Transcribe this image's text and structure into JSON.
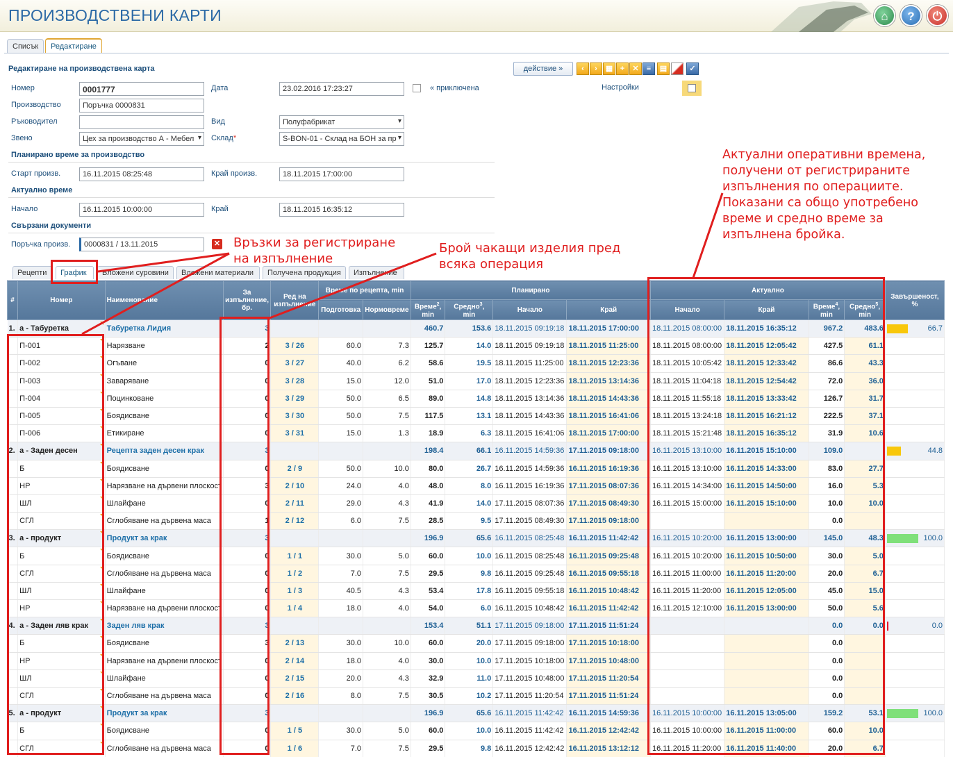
{
  "header": {
    "title": "ПРОИЗВОДСТВЕНИ КАРТИ",
    "home_icon": "home-icon",
    "help_icon": "help-icon",
    "power_icon": "power-icon"
  },
  "main_tabs": [
    "Списък",
    "Редактиране"
  ],
  "form": {
    "title": "Редактиране на производствена карта",
    "action_label": "действие  »",
    "fields": {
      "nomer_label": "Номер",
      "nomer": "0001777",
      "data_label": "Дата",
      "data": "23.02.2016 17:23:27",
      "closed_label": "« приключена",
      "settings_label": "Настройки",
      "proizv_label": "Производство",
      "proizv": "Поръчка 0000831",
      "rakovod_label": "Ръководител",
      "rakovod": "",
      "vid_label": "Вид",
      "vid": "Полуфабрикат",
      "zveno_label": "Звено",
      "zveno": "Цех за производство А - Мебел",
      "sklad_label": "Склад",
      "sklad": "S-BON-01 - Склад на БОН за пр"
    },
    "planned": {
      "title": "Планирано време за производство",
      "start_label": "Старт произв.",
      "start": "16.11.2015 08:25:48",
      "end_label": "Край произв.",
      "end": "18.11.2015 17:00:00"
    },
    "actual": {
      "title": "Актуално време",
      "start_label": "Начало",
      "start": "16.11.2015 10:00:00",
      "end_label": "Край",
      "end": "18.11.2015 16:35:12"
    },
    "docs": {
      "title": "Свързани документи",
      "order_label": "Поръчка произв.",
      "order": "0000831 / 13.11.2015"
    }
  },
  "sub_tabs": [
    "Рецепти",
    "График",
    "Вложени суровини",
    "Вложени материали",
    "Получена продукция",
    "Изпълнение"
  ],
  "grid": {
    "headers": {
      "idx": "#",
      "num": "Номер",
      "name": "Наименование",
      "qty": "За изпълнение, бр.",
      "order": "Ред на изпълнение",
      "recipe": "Време по рецепта, min",
      "prep": "Подготовка",
      "norm": "Нормовреме",
      "planned": "Планирано",
      "actual": "Актуално",
      "p_time": "Време",
      "p_avg": "Средно",
      "min": "min",
      "start": "Начало",
      "end": "Край",
      "completion": "Завършеност, %",
      "sup2": "2",
      "sup3": "3",
      "sup4": "4",
      "sup5": "5"
    },
    "rows": [
      {
        "g": 1,
        "idx": "1.",
        "num": "а - Табуретка",
        "name": "Табуретка Лидия",
        "qty": "3",
        "ord": "",
        "prep": "",
        "norm": "",
        "pt": "460.7",
        "pa": "153.6",
        "ps": "18.11.2015 09:19:18",
        "pe": "18.11.2015 17:00:00",
        "as": "18.11.2015 08:00:00",
        "ae": "18.11.2015 16:35:12",
        "at": "967.2",
        "aa": "483.6",
        "pct": "66.7",
        "bar": 0.667,
        "barc": "#f8c70b"
      },
      {
        "g": 0,
        "num": "П-001",
        "name": "Нарязване",
        "qty": "2",
        "ord": "3 / 26",
        "prep": "60.0",
        "norm": "7.3",
        "pt": "125.7",
        "pa": "14.0",
        "ps": "18.11.2015 09:19:18",
        "pe": "18.11.2015 11:25:00",
        "as": "18.11.2015 08:00:00",
        "ae": "18.11.2015 12:05:42",
        "at": "427.5",
        "aa": "61.1"
      },
      {
        "g": 0,
        "num": "П-002",
        "name": "Огъване",
        "qty": "0",
        "ord": "3 / 27",
        "prep": "40.0",
        "norm": "6.2",
        "pt": "58.6",
        "pa": "19.5",
        "ps": "18.11.2015 11:25:00",
        "pe": "18.11.2015 12:23:36",
        "as": "18.11.2015 10:05:42",
        "ae": "18.11.2015 12:33:42",
        "at": "86.6",
        "aa": "43.3"
      },
      {
        "g": 0,
        "num": "П-003",
        "name": "Заваряване",
        "qty": "0",
        "ord": "3 / 28",
        "prep": "15.0",
        "norm": "12.0",
        "pt": "51.0",
        "pa": "17.0",
        "ps": "18.11.2015 12:23:36",
        "pe": "18.11.2015 13:14:36",
        "as": "18.11.2015 11:04:18",
        "ae": "18.11.2015 12:54:42",
        "at": "72.0",
        "aa": "36.0"
      },
      {
        "g": 0,
        "num": "П-004",
        "name": "Поцинковане",
        "qty": "0",
        "ord": "3 / 29",
        "prep": "50.0",
        "norm": "6.5",
        "pt": "89.0",
        "pa": "14.8",
        "ps": "18.11.2015 13:14:36",
        "pe": "18.11.2015 14:43:36",
        "as": "18.11.2015 11:55:18",
        "ae": "18.11.2015 13:33:42",
        "at": "126.7",
        "aa": "31.7"
      },
      {
        "g": 0,
        "num": "П-005",
        "name": "Боядисване",
        "qty": "0",
        "ord": "3 / 30",
        "prep": "50.0",
        "norm": "7.5",
        "pt": "117.5",
        "pa": "13.1",
        "ps": "18.11.2015 14:43:36",
        "pe": "18.11.2015 16:41:06",
        "as": "18.11.2015 13:24:18",
        "ae": "18.11.2015 16:21:12",
        "at": "222.5",
        "aa": "37.1"
      },
      {
        "g": 0,
        "num": "П-006",
        "name": "Етикиране",
        "qty": "0",
        "ord": "3 / 31",
        "prep": "15.0",
        "norm": "1.3",
        "pt": "18.9",
        "pa": "6.3",
        "ps": "18.11.2015 16:41:06",
        "pe": "18.11.2015 17:00:00",
        "as": "18.11.2015 15:21:48",
        "ae": "18.11.2015 16:35:12",
        "at": "31.9",
        "aa": "10.6"
      },
      {
        "g": 1,
        "idx": "2.",
        "num": "а - Заден десен",
        "name": "Рецепта заден десен крак",
        "qty": "3",
        "ord": "",
        "prep": "",
        "norm": "",
        "pt": "198.4",
        "pa": "66.1",
        "ps": "16.11.2015 14:59:36",
        "pe": "17.11.2015 09:18:00",
        "as": "16.11.2015 13:10:00",
        "ae": "16.11.2015 15:10:00",
        "at": "109.0",
        "aa": "",
        "pct": "44.8",
        "bar": 0.448,
        "barc": "#f8c70b"
      },
      {
        "g": 0,
        "num": "Б",
        "name": "Боядисване",
        "qty": "0",
        "ord": "2 / 9",
        "prep": "50.0",
        "norm": "10.0",
        "pt": "80.0",
        "pa": "26.7",
        "ps": "16.11.2015 14:59:36",
        "pe": "16.11.2015 16:19:36",
        "as": "16.11.2015 13:10:00",
        "ae": "16.11.2015 14:33:00",
        "at": "83.0",
        "aa": "27.7"
      },
      {
        "g": 0,
        "num": "НР",
        "name": "Нарязване на дървени плоскост",
        "qty": "3",
        "ord": "2 / 10",
        "prep": "24.0",
        "norm": "4.0",
        "pt": "48.0",
        "pa": "8.0",
        "ps": "16.11.2015 16:19:36",
        "pe": "17.11.2015 08:07:36",
        "as": "16.11.2015 14:34:00",
        "ae": "16.11.2015 14:50:00",
        "at": "16.0",
        "aa": "5.3"
      },
      {
        "g": 0,
        "num": "ШЛ",
        "name": "Шлайфане",
        "qty": "0",
        "ord": "2 / 11",
        "prep": "29.0",
        "norm": "4.3",
        "pt": "41.9",
        "pa": "14.0",
        "ps": "17.11.2015 08:07:36",
        "pe": "17.11.2015 08:49:30",
        "as": "16.11.2015 15:00:00",
        "ae": "16.11.2015 15:10:00",
        "at": "10.0",
        "aa": "10.0"
      },
      {
        "g": 0,
        "num": "СГЛ",
        "name": "Сглобяване на дървена маса",
        "qty": "1",
        "ord": "2 / 12",
        "prep": "6.0",
        "norm": "7.5",
        "pt": "28.5",
        "pa": "9.5",
        "ps": "17.11.2015 08:49:30",
        "pe": "17.11.2015 09:18:00",
        "as": "",
        "ae": "",
        "at": "0.0",
        "aa": ""
      },
      {
        "g": 1,
        "idx": "3.",
        "num": "а - продукт",
        "name": "Продукт за крак",
        "qty": "3",
        "ord": "",
        "prep": "",
        "norm": "",
        "pt": "196.9",
        "pa": "65.6",
        "ps": "16.11.2015 08:25:48",
        "pe": "16.11.2015 11:42:42",
        "as": "16.11.2015 10:20:00",
        "ae": "16.11.2015 13:00:00",
        "at": "145.0",
        "aa": "48.3",
        "pct": "100.0",
        "bar": 1,
        "barc": "#7fe07a"
      },
      {
        "g": 0,
        "num": "Б",
        "name": "Боядисване",
        "qty": "0",
        "ord": "1 / 1",
        "prep": "30.0",
        "norm": "5.0",
        "pt": "60.0",
        "pa": "10.0",
        "ps": "16.11.2015 08:25:48",
        "pe": "16.11.2015 09:25:48",
        "as": "16.11.2015 10:20:00",
        "ae": "16.11.2015 10:50:00",
        "at": "30.0",
        "aa": "5.0"
      },
      {
        "g": 0,
        "num": "СГЛ",
        "name": "Сглобяване на дървена маса",
        "qty": "0",
        "ord": "1 / 2",
        "prep": "7.0",
        "norm": "7.5",
        "pt": "29.5",
        "pa": "9.8",
        "ps": "16.11.2015 09:25:48",
        "pe": "16.11.2015 09:55:18",
        "as": "16.11.2015 11:00:00",
        "ae": "16.11.2015 11:20:00",
        "at": "20.0",
        "aa": "6.7"
      },
      {
        "g": 0,
        "num": "ШЛ",
        "name": "Шлайфане",
        "qty": "0",
        "ord": "1 / 3",
        "prep": "40.5",
        "norm": "4.3",
        "pt": "53.4",
        "pa": "17.8",
        "ps": "16.11.2015 09:55:18",
        "pe": "16.11.2015 10:48:42",
        "as": "16.11.2015 11:20:00",
        "ae": "16.11.2015 12:05:00",
        "at": "45.0",
        "aa": "15.0"
      },
      {
        "g": 0,
        "num": "НР",
        "name": "Нарязване на дървени плоскост",
        "qty": "0",
        "ord": "1 / 4",
        "prep": "18.0",
        "norm": "4.0",
        "pt": "54.0",
        "pa": "6.0",
        "ps": "16.11.2015 10:48:42",
        "pe": "16.11.2015 11:42:42",
        "as": "16.11.2015 12:10:00",
        "ae": "16.11.2015 13:00:00",
        "at": "50.0",
        "aa": "5.6"
      },
      {
        "g": 1,
        "idx": "4.",
        "num": "а - Заден ляв крак",
        "name": "Заден ляв крак",
        "qty": "3",
        "ord": "",
        "prep": "",
        "norm": "",
        "pt": "153.4",
        "pa": "51.1",
        "ps": "17.11.2015 09:18:00",
        "pe": "17.11.2015 11:51:24",
        "as": "",
        "ae": "",
        "at": "0.0",
        "aa": "0.0",
        "pct": "0.0",
        "bar": 0.02,
        "barc": "#e8002a"
      },
      {
        "g": 0,
        "num": "Б",
        "name": "Боядисване",
        "qty": "3",
        "ord": "2 / 13",
        "prep": "30.0",
        "norm": "10.0",
        "pt": "60.0",
        "pa": "20.0",
        "ps": "17.11.2015 09:18:00",
        "pe": "17.11.2015 10:18:00",
        "as": "",
        "ae": "",
        "at": "0.0",
        "aa": ""
      },
      {
        "g": 0,
        "num": "НР",
        "name": "Нарязване на дървени плоскост",
        "qty": "0",
        "ord": "2 / 14",
        "prep": "18.0",
        "norm": "4.0",
        "pt": "30.0",
        "pa": "10.0",
        "ps": "17.11.2015 10:18:00",
        "pe": "17.11.2015 10:48:00",
        "as": "",
        "ae": "",
        "at": "0.0",
        "aa": ""
      },
      {
        "g": 0,
        "num": "ШЛ",
        "name": "Шлайфане",
        "qty": "0",
        "ord": "2 / 15",
        "prep": "20.0",
        "norm": "4.3",
        "pt": "32.9",
        "pa": "11.0",
        "ps": "17.11.2015 10:48:00",
        "pe": "17.11.2015 11:20:54",
        "as": "",
        "ae": "",
        "at": "0.0",
        "aa": ""
      },
      {
        "g": 0,
        "num": "СГЛ",
        "name": "Сглобяване на дървена маса",
        "qty": "0",
        "ord": "2 / 16",
        "prep": "8.0",
        "norm": "7.5",
        "pt": "30.5",
        "pa": "10.2",
        "ps": "17.11.2015 11:20:54",
        "pe": "17.11.2015 11:51:24",
        "as": "",
        "ae": "",
        "at": "0.0",
        "aa": ""
      },
      {
        "g": 1,
        "idx": "5.",
        "num": "а - продукт",
        "name": "Продукт за крак",
        "qty": "3",
        "ord": "",
        "prep": "",
        "norm": "",
        "pt": "196.9",
        "pa": "65.6",
        "ps": "16.11.2015 11:42:42",
        "pe": "16.11.2015 14:59:36",
        "as": "16.11.2015 10:00:00",
        "ae": "16.11.2015 13:05:00",
        "at": "159.2",
        "aa": "53.1",
        "pct": "100.0",
        "bar": 1,
        "barc": "#7fe07a"
      },
      {
        "g": 0,
        "num": "Б",
        "name": "Боядисване",
        "qty": "0",
        "ord": "1 / 5",
        "prep": "30.0",
        "norm": "5.0",
        "pt": "60.0",
        "pa": "10.0",
        "ps": "16.11.2015 11:42:42",
        "pe": "16.11.2015 12:42:42",
        "as": "16.11.2015 10:00:00",
        "ae": "16.11.2015 11:00:00",
        "at": "60.0",
        "aa": "10.0"
      },
      {
        "g": 0,
        "num": "СГЛ",
        "name": "Сглобяване на дървена маса",
        "qty": "0",
        "ord": "1 / 6",
        "prep": "7.0",
        "norm": "7.5",
        "pt": "29.5",
        "pa": "9.8",
        "ps": "16.11.2015 12:42:42",
        "pe": "16.11.2015 13:12:12",
        "as": "16.11.2015 11:20:00",
        "ae": "16.11.2015 11:40:00",
        "at": "20.0",
        "aa": "6.7"
      }
    ]
  },
  "annotations": {
    "links": "Връзки за регистриране на изпълнение",
    "waiting": "Брой чакащи изделия пред всяка операция",
    "actual": "Актуални оперативни времена, получени от регистрираните изпълнения по операциите. Показани са общо употребено време и средно време за изпълнена бройка."
  },
  "colors": {
    "accent": "#2c6aa6",
    "annotation": "#e01e1e",
    "header_grid": "#5f7fa3"
  }
}
